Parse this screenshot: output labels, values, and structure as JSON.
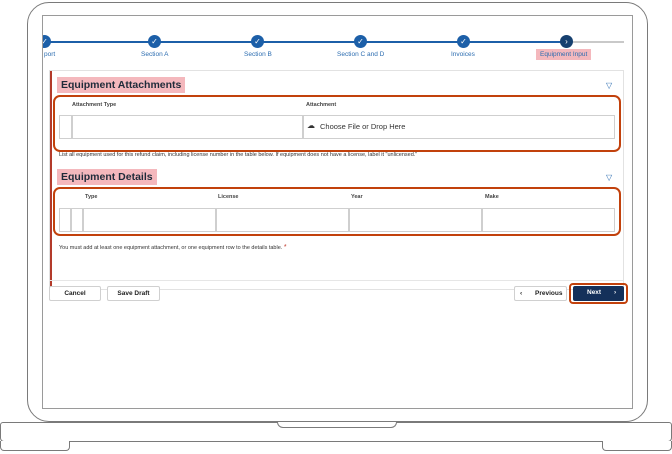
{
  "stepper": {
    "steps": [
      {
        "label": "Report"
      },
      {
        "label": "Section A"
      },
      {
        "label": "Section B"
      },
      {
        "label": "Section C and D"
      },
      {
        "label": "Invoices"
      },
      {
        "label": "Equipment Input"
      }
    ],
    "visible_first_label": "port",
    "check_glyph": "✓",
    "current_glyph": "›"
  },
  "attachments": {
    "title": "Equipment Attachments",
    "col_type": "Attachment Type",
    "col_attachment": "Attachment",
    "upload_text": "Choose File or Drop Here",
    "helper": "List all equipment used for this refund claim, including license number in the table below. If equipment does not have a license, label it \"unlicensed.\""
  },
  "details": {
    "title": "Equipment Details",
    "columns": [
      "Type",
      "License",
      "Year",
      "Make"
    ],
    "helper": "You must add at least one equipment attachment, or one equipment row to the details table.",
    "required_mark": "*"
  },
  "footer": {
    "cancel_label": "Cancel",
    "save_draft_label": "Save Draft",
    "previous_label": "Previous",
    "next_label": "Next"
  },
  "colors": {
    "accent_blue": "#1c5fa8",
    "navy": "#14305a",
    "highlight_pink": "#f4b8bd",
    "callout_orange": "#c2410c"
  },
  "icons": {
    "filter": "filter-icon",
    "upload": "cloud-upload-icon",
    "check": "check-icon",
    "chevron_left": "chevron-left-icon",
    "chevron_right": "chevron-right-icon"
  }
}
